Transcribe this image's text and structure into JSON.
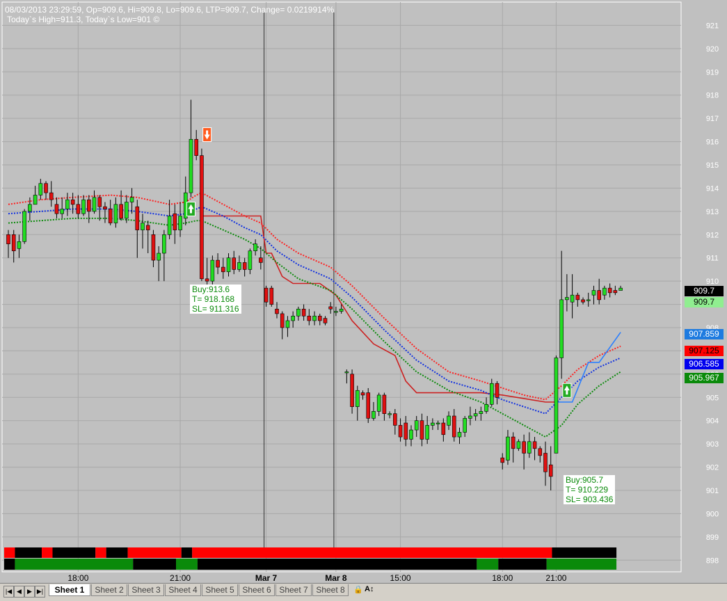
{
  "header": {
    "line1": "08/03/2013 23:29:59, Op=909.6, Hi=909.8, Lo=909.6, LTP=909.7, Change= 0.0219914%",
    "line2": "Today`s High=911.3, Today`s Low=901 ©"
  },
  "trades": [
    {
      "buy": "Buy:913.6",
      "target": "T= 918.168",
      "stoploss": "SL= 911.316"
    },
    {
      "buy": "Buy:905.7",
      "target": "T= 910.229",
      "stoploss": "SL= 903.436"
    }
  ],
  "price_tags": [
    {
      "value": "909.7",
      "bg": "#000000",
      "fg": "#ffffff"
    },
    {
      "value": "909.7",
      "bg": "#90ee90",
      "fg": "#000000"
    },
    {
      "value": "907.859",
      "bg": "#1e7be0",
      "fg": "#ffffff"
    },
    {
      "value": "907.125",
      "bg": "#ff0000",
      "fg": "#000000"
    },
    {
      "value": "906.585",
      "bg": "#0000ee",
      "fg": "#ffffff"
    },
    {
      "value": "905.967",
      "bg": "#0a8a0a",
      "fg": "#ffffff"
    }
  ],
  "colors": {
    "bull": "#22dd22",
    "bear": "#e01010",
    "ema_red": "#ff2020",
    "ema_blue": "#1030e0",
    "ema_green": "#0a8a0a",
    "stop_line": "#cc2020",
    "blue_line": "#2a7fff"
  },
  "chart_data": {
    "type": "candlestick",
    "ylim": [
      897.5,
      922
    ],
    "y_ticks": [
      898,
      899,
      900,
      901,
      902,
      903,
      904,
      905,
      906,
      907,
      908,
      909,
      910,
      911,
      912,
      913,
      914,
      915,
      916,
      917,
      918,
      919,
      920,
      921
    ],
    "x_labels": [
      "18:00",
      "21:00",
      "Mar 7",
      "Mar 8",
      "15:00",
      "18:00",
      "21:00"
    ],
    "x_label_bars": [
      13,
      32,
      48,
      61,
      73,
      92,
      102
    ],
    "vertical_separator_bars": [
      48,
      61
    ],
    "candles": [
      [
        0,
        912,
        911.6,
        912.2,
        911
      ],
      [
        1,
        912,
        911.3,
        912.2,
        910.8
      ],
      [
        2,
        911.4,
        911.7,
        912,
        911
      ],
      [
        3,
        911.7,
        913,
        913.1,
        911.6
      ],
      [
        4,
        913,
        913.3,
        913.6,
        912.6
      ],
      [
        5,
        913.3,
        913.7,
        914.1,
        913.3
      ],
      [
        6,
        913.7,
        914.2,
        914.4,
        913.5
      ],
      [
        7,
        914.2,
        913.8,
        914.3,
        913.5
      ],
      [
        8,
        913.8,
        913.5,
        914.3,
        913.2
      ],
      [
        9,
        913.3,
        912.9,
        913.6,
        912.7
      ],
      [
        10,
        912.9,
        913.1,
        913.6,
        912.7
      ],
      [
        11,
        913.1,
        913.5,
        913.8,
        912.8
      ],
      [
        12,
        913.5,
        913.3,
        913.8,
        912.9
      ],
      [
        13,
        913.3,
        912.9,
        913.7,
        912.7
      ],
      [
        14,
        912.9,
        913.5,
        913.7,
        912.8
      ],
      [
        15,
        913.5,
        913,
        913.7,
        912.5
      ],
      [
        16,
        913,
        913.6,
        913.9,
        912.9
      ],
      [
        17,
        913.6,
        913.2,
        913.7,
        912.6
      ],
      [
        18,
        913.2,
        913.1,
        913.4,
        912.5
      ],
      [
        19,
        913.1,
        912.5,
        913.5,
        912.4
      ],
      [
        20,
        912.5,
        913.3,
        913.6,
        912.3
      ],
      [
        21,
        913.3,
        912.7,
        913.9,
        912.6
      ],
      [
        22,
        912.7,
        913.4,
        913.7,
        912.5
      ],
      [
        23,
        913.4,
        913.6,
        914,
        912.9
      ],
      [
        24,
        913.2,
        912.2,
        913.5,
        911
      ],
      [
        25,
        912.2,
        912.5,
        912.9,
        911.4
      ],
      [
        26,
        912.4,
        912.2,
        912.6,
        911.2
      ],
      [
        27,
        912,
        910.9,
        912.2,
        910.6
      ],
      [
        28,
        910.9,
        911.2,
        911.5,
        910
      ],
      [
        29,
        911.2,
        912,
        912.2,
        910
      ],
      [
        30,
        912,
        912.8,
        913.5,
        911.8
      ],
      [
        31,
        912.9,
        912.2,
        913.3,
        911.6
      ],
      [
        32,
        912.2,
        912.8,
        913.4,
        911.9
      ],
      [
        33,
        912.7,
        913.8,
        914.5,
        912.4
      ],
      [
        34,
        913.8,
        916.1,
        917.8,
        913.6
      ],
      [
        35,
        916.1,
        915.4,
        916.5,
        915.2
      ],
      [
        36,
        915.4,
        910.1,
        915.7,
        910
      ],
      [
        37,
        910.1,
        910,
        911,
        909.8
      ],
      [
        38,
        910,
        910.9,
        911.1,
        909.7
      ],
      [
        39,
        910.9,
        910.6,
        911.2,
        910.3
      ],
      [
        40,
        910.6,
        910.4,
        911,
        910.1
      ],
      [
        41,
        910.4,
        911,
        911.2,
        910.2
      ],
      [
        42,
        911,
        910.5,
        911.3,
        910.3
      ],
      [
        43,
        910.5,
        910.8,
        911.1,
        910.4
      ],
      [
        44,
        910.8,
        910.5,
        911,
        910.2
      ],
      [
        45,
        910.5,
        911.3,
        911.4,
        910.3
      ],
      [
        46,
        911.3,
        911.6,
        911.8,
        911.1
      ],
      [
        47,
        911,
        910.8,
        911.5,
        910.5
      ],
      [
        48,
        909.7,
        909.1,
        909.8,
        908.9
      ],
      [
        49,
        909.7,
        909,
        909.8,
        908.9
      ],
      [
        50,
        908.8,
        908.6,
        909.1,
        908.4
      ],
      [
        51,
        908.6,
        908,
        908.7,
        907.5
      ],
      [
        52,
        908,
        908.3,
        908.5,
        907.6
      ],
      [
        53,
        908.3,
        908.5,
        908.7,
        908
      ],
      [
        54,
        908.5,
        908.8,
        908.9,
        908.3
      ],
      [
        55,
        908.8,
        908.5,
        909,
        908.3
      ],
      [
        56,
        908.5,
        908.3,
        908.8,
        908.1
      ],
      [
        57,
        908.3,
        908.5,
        908.7,
        908.1
      ],
      [
        58,
        908.5,
        908.3,
        908.6,
        908.1
      ],
      [
        59,
        908.4,
        908.2,
        908.5,
        908.1
      ],
      [
        60,
        908.9,
        908.8,
        909.1,
        908.6
      ],
      [
        61,
        908.7,
        908.7,
        908.9,
        908.5
      ],
      [
        62,
        908.7,
        908.8,
        909,
        908.6
      ],
      [
        63,
        906.1,
        906.1,
        906.2,
        905.6
      ],
      [
        64,
        906,
        904.6,
        906.2,
        904.3
      ],
      [
        65,
        904.6,
        905.3,
        905.5,
        904
      ],
      [
        66,
        905.2,
        905.1,
        905.3,
        904.9
      ],
      [
        67,
        905.2,
        904.1,
        905.4,
        903.9
      ],
      [
        68,
        904.1,
        904.4,
        904.8,
        904
      ],
      [
        69,
        904.4,
        905.1,
        905.2,
        904.2
      ],
      [
        70,
        905.1,
        904.3,
        905.2,
        904
      ],
      [
        71,
        904.3,
        904.3,
        904.4,
        904.1
      ],
      [
        72,
        904.3,
        903.8,
        904.5,
        903.4
      ],
      [
        73,
        903.8,
        903.3,
        904.1,
        903.1
      ],
      [
        74,
        903.9,
        903.2,
        904.2,
        902.9
      ],
      [
        75,
        903.2,
        903.6,
        903.8,
        902.9
      ],
      [
        76,
        903.6,
        904,
        904.2,
        903.3
      ],
      [
        77,
        904,
        903.2,
        904.3,
        902.9
      ],
      [
        78,
        903.2,
        903.8,
        904.2,
        903
      ],
      [
        79,
        903.8,
        903.9,
        904.1,
        903.6
      ],
      [
        80,
        903.9,
        903.9,
        904,
        903.6
      ],
      [
        81,
        903.9,
        903.4,
        904.1,
        903.1
      ],
      [
        82,
        903.8,
        904.2,
        904.4,
        903.6
      ],
      [
        83,
        904.2,
        903.3,
        904.5,
        903.1
      ],
      [
        84,
        903.3,
        903.5,
        903.7,
        903
      ],
      [
        85,
        903.5,
        904.1,
        904.2,
        903.3
      ],
      [
        86,
        904.1,
        904.2,
        904.6,
        903.8
      ],
      [
        87,
        904.2,
        904.3,
        904.5,
        904
      ],
      [
        88,
        904.3,
        904.4,
        904.6,
        904
      ],
      [
        89,
        904.4,
        904.7,
        905,
        904.3
      ],
      [
        90,
        904.7,
        905.6,
        905.8,
        904.6
      ],
      [
        91,
        905.6,
        905,
        905.7,
        904.7
      ],
      [
        92,
        902.4,
        902.2,
        902.6,
        901.9
      ],
      [
        93,
        902.3,
        903.3,
        903.6,
        902.1
      ],
      [
        94,
        903.3,
        902.8,
        903.5,
        902.2
      ],
      [
        95,
        902.8,
        903.1,
        903.2,
        902.7
      ],
      [
        96,
        903.1,
        902.6,
        903.4,
        901.9
      ],
      [
        97,
        902.6,
        903.1,
        903.5,
        902.4
      ],
      [
        98,
        903.1,
        902.8,
        903.3,
        902.3
      ],
      [
        99,
        902.8,
        902.5,
        902.9,
        902.2
      ],
      [
        100,
        902.6,
        901.8,
        903.1,
        901.2
      ],
      [
        101,
        902.1,
        901.6,
        902.9,
        901
      ],
      [
        102,
        902.6,
        906.7,
        906.8,
        902.6
      ],
      [
        103,
        906.7,
        909.2,
        911.3,
        905.8
      ],
      [
        104,
        909.2,
        909.3,
        910.3,
        908.7
      ],
      [
        105,
        909.1,
        909.4,
        910.3,
        908.4
      ],
      [
        106,
        909.4,
        909.2,
        909.5,
        908.9
      ],
      [
        107,
        909.2,
        909.1,
        909.3,
        909
      ],
      [
        108,
        909.2,
        909.2,
        909.5,
        908.9
      ],
      [
        109,
        909.4,
        909.6,
        909.8,
        909
      ],
      [
        110,
        909.6,
        909.2,
        910.1,
        909
      ],
      [
        111,
        909.4,
        909.7,
        909.8,
        909.2
      ],
      [
        112,
        909.7,
        909.5,
        909.9,
        909.3
      ],
      [
        113,
        909.6,
        909.5,
        909.8,
        909.4
      ],
      [
        114,
        909.6,
        909.7,
        909.8,
        909.6
      ]
    ],
    "ema_red": [
      [
        0,
        913.3
      ],
      [
        6,
        913.5
      ],
      [
        12,
        913.6
      ],
      [
        19,
        913.7
      ],
      [
        24,
        913.6
      ],
      [
        30,
        913.3
      ],
      [
        33,
        913.4
      ],
      [
        35,
        913.7
      ],
      [
        36,
        913.8
      ],
      [
        40,
        913.3
      ],
      [
        44,
        912.8
      ],
      [
        47,
        912.5
      ],
      [
        50,
        911.8
      ],
      [
        54,
        911.2
      ],
      [
        60,
        910.6
      ],
      [
        64,
        909.8
      ],
      [
        70,
        908.4
      ],
      [
        76,
        907.1
      ],
      [
        82,
        906.1
      ],
      [
        88,
        905.7
      ],
      [
        92,
        905.4
      ],
      [
        96,
        905.1
      ],
      [
        100,
        904.9
      ],
      [
        103,
        905.5
      ],
      [
        106,
        906.2
      ],
      [
        110,
        906.8
      ],
      [
        114,
        907.2
      ]
    ],
    "ema_blue": [
      [
        0,
        912.9
      ],
      [
        6,
        913
      ],
      [
        12,
        913.1
      ],
      [
        19,
        913.1
      ],
      [
        24,
        913
      ],
      [
        30,
        912.8
      ],
      [
        33,
        912.9
      ],
      [
        35,
        913.1
      ],
      [
        36,
        913.2
      ],
      [
        40,
        912.8
      ],
      [
        44,
        912.3
      ],
      [
        47,
        912
      ],
      [
        50,
        911.3
      ],
      [
        54,
        910.7
      ],
      [
        60,
        910.1
      ],
      [
        64,
        909.3
      ],
      [
        70,
        907.9
      ],
      [
        76,
        906.6
      ],
      [
        82,
        905.7
      ],
      [
        88,
        905.3
      ],
      [
        92,
        904.9
      ],
      [
        96,
        904.6
      ],
      [
        100,
        904.3
      ],
      [
        103,
        905
      ],
      [
        106,
        905.7
      ],
      [
        110,
        906.3
      ],
      [
        114,
        906.7
      ]
    ],
    "ema_green": [
      [
        0,
        912.5
      ],
      [
        6,
        912.6
      ],
      [
        12,
        912.7
      ],
      [
        19,
        912.7
      ],
      [
        24,
        912.6
      ],
      [
        30,
        912.4
      ],
      [
        33,
        912.5
      ],
      [
        35,
        912.6
      ],
      [
        36,
        912.6
      ],
      [
        40,
        912.2
      ],
      [
        44,
        911.8
      ],
      [
        47,
        911.4
      ],
      [
        50,
        910.8
      ],
      [
        54,
        910.1
      ],
      [
        60,
        909.6
      ],
      [
        64,
        908.8
      ],
      [
        70,
        907.4
      ],
      [
        76,
        906.1
      ],
      [
        82,
        905.3
      ],
      [
        88,
        904.8
      ],
      [
        92,
        904.3
      ],
      [
        96,
        903.8
      ],
      [
        100,
        903.3
      ],
      [
        103,
        903.8
      ],
      [
        106,
        904.7
      ],
      [
        110,
        905.5
      ],
      [
        114,
        906.1
      ]
    ],
    "stop_line": [
      [
        36,
        912.8
      ],
      [
        47,
        912.8
      ],
      [
        48,
        911.2
      ],
      [
        49,
        911.2
      ],
      [
        51,
        910.2
      ],
      [
        53,
        909.9
      ],
      [
        58,
        909.9
      ],
      [
        61,
        909.4
      ],
      [
        64,
        908.3
      ],
      [
        68,
        907.3
      ],
      [
        72,
        906.8
      ],
      [
        74,
        905.7
      ],
      [
        76,
        905.2
      ],
      [
        88,
        905.2
      ],
      [
        92,
        905.1
      ],
      [
        100,
        904.8
      ],
      [
        102,
        904.8
      ]
    ],
    "blue_line": [
      [
        102,
        904.8
      ],
      [
        105,
        904.8
      ],
      [
        108,
        906.5
      ],
      [
        110,
        906.5
      ],
      [
        114,
        907.8
      ]
    ],
    "signals": [
      {
        "bar": 34,
        "dir": "up",
        "price": 913.1,
        "color": "#22aa22"
      },
      {
        "bar": 37,
        "dir": "down",
        "price": 916.3,
        "color": "#ff5a1e"
      },
      {
        "bar": 104,
        "dir": "up",
        "price": 905.3,
        "color": "#22aa22"
      }
    ],
    "status_bar_top": [
      [
        "#ff0000",
        0,
        2
      ],
      [
        "#000000",
        2,
        7
      ],
      [
        "#ff0000",
        7,
        9
      ],
      [
        "#000000",
        9,
        17
      ],
      [
        "#ff0000",
        17,
        19
      ],
      [
        "#000000",
        19,
        23
      ],
      [
        "#ff0000",
        23,
        33
      ],
      [
        "#000000",
        33,
        35
      ],
      [
        "#ff0000",
        35,
        102
      ],
      [
        "#000000",
        102,
        114
      ]
    ],
    "status_bar_bottom": [
      [
        "#000000",
        0,
        2
      ],
      [
        "#0a8a0a",
        2,
        24
      ],
      [
        "#000000",
        24,
        32
      ],
      [
        "#0a8a0a",
        32,
        36
      ],
      [
        "#000000",
        36,
        88
      ],
      [
        "#0a8a0a",
        88,
        92
      ],
      [
        "#000000",
        92,
        101
      ],
      [
        "#0a8a0a",
        101,
        114
      ]
    ]
  },
  "tabs": {
    "nav_buttons": [
      "|◀",
      "◀",
      "▶",
      "▶|"
    ],
    "sheets": [
      "Sheet 1",
      "Sheet 2",
      "Sheet 3",
      "Sheet 4",
      "Sheet 5",
      "Sheet 6",
      "Sheet 7",
      "Sheet 8"
    ],
    "active_index": 0,
    "lock_icon": "lock-icon",
    "font_icon": "font-size-icon"
  }
}
